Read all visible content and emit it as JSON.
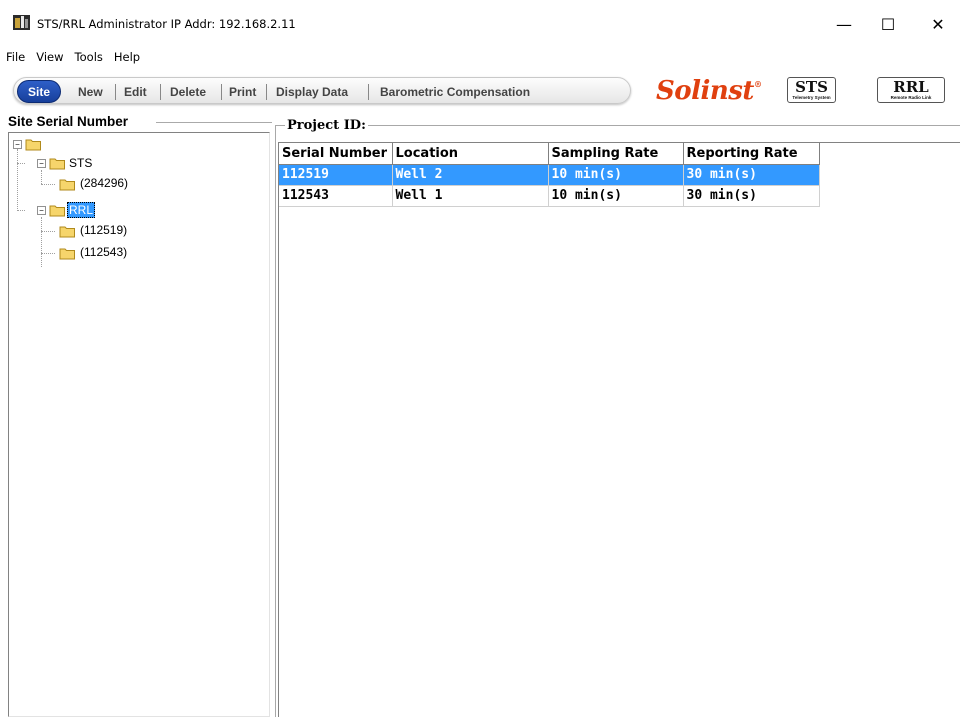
{
  "window": {
    "title": "STS/RRL Administrator IP Addr: 192.168.2.11",
    "minimize": "—",
    "maximize": "☐",
    "close": "✕"
  },
  "menu": [
    "File",
    "View",
    "Tools",
    "Help"
  ],
  "toolbar": {
    "site": "Site",
    "new": "New",
    "edit": "Edit",
    "delete": "Delete",
    "print": "Print",
    "display_data": "Display Data",
    "barometric": "Barometric Compensation"
  },
  "logos": {
    "solinst": "Solinst",
    "solinst_reg": "®",
    "sts_big": "STS",
    "sts_small": "Telemetry System",
    "rrl_big": "RRL",
    "rrl_small": "Remote Radio Link"
  },
  "tree": {
    "title": "Site Serial Number",
    "nodes": {
      "sts": "STS",
      "sts_child": "(284296)",
      "rrl": "RRL",
      "rrl_child1": "(112519)",
      "rrl_child2": "(112543)"
    }
  },
  "project": {
    "title": "Project ID:",
    "columns": [
      "Serial Number",
      "Location",
      "Sampling Rate",
      "Reporting Rate"
    ],
    "rows": [
      [
        "112519",
        "Well 2",
        "10 min(s)",
        "30 min(s)"
      ],
      [
        "112543",
        "Well 1",
        "10 min(s)",
        "30 min(s)"
      ]
    ]
  },
  "colors": {
    "selection": "#3399ff",
    "site_button": "#1e4ab0",
    "solinst": "#e0400f"
  }
}
